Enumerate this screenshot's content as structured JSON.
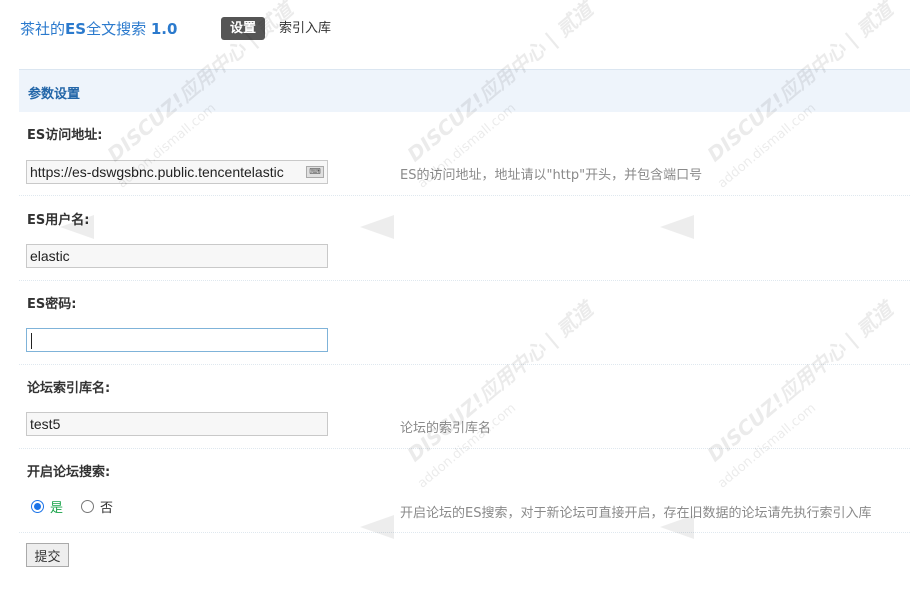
{
  "header": {
    "title_prefix": "茶社的",
    "title_es": "ES",
    "title_mid": "全文搜索 ",
    "title_version": "1.0",
    "tabs": [
      {
        "label": "设置",
        "active": true
      },
      {
        "label": "索引入库",
        "active": false
      }
    ]
  },
  "section": {
    "title": "参数设置"
  },
  "fields": {
    "es_url": {
      "label": "ES访问地址:",
      "value": "https://es-dswgsbnc.public.tencentelastic",
      "hint": "ES的访问地址，地址请以\"http\"开头，并包含端口号"
    },
    "es_user": {
      "label": "ES用户名:",
      "value": "elastic"
    },
    "es_password": {
      "label": "ES密码:",
      "value": ""
    },
    "forum_index": {
      "label": "论坛索引库名:",
      "value": "test5",
      "hint": "论坛的索引库名"
    },
    "enable_search": {
      "label": "开启论坛搜索:",
      "options": [
        {
          "label": "是",
          "checked": true
        },
        {
          "label": "否",
          "checked": false
        }
      ],
      "hint": "开启论坛的ES搜索，对于新论坛可直接开启，存在旧数据的论坛请先执行索引入库"
    }
  },
  "submit_label": "提交",
  "watermark": {
    "line1": "DISCUZ!应用中心 | 贰道",
    "line2": "addon.dismall.com"
  },
  "colors": {
    "title": "#2b7acd",
    "section_bg": "#eef4fb",
    "active_tab": "#555555",
    "yes_option": "#1aa34a"
  }
}
